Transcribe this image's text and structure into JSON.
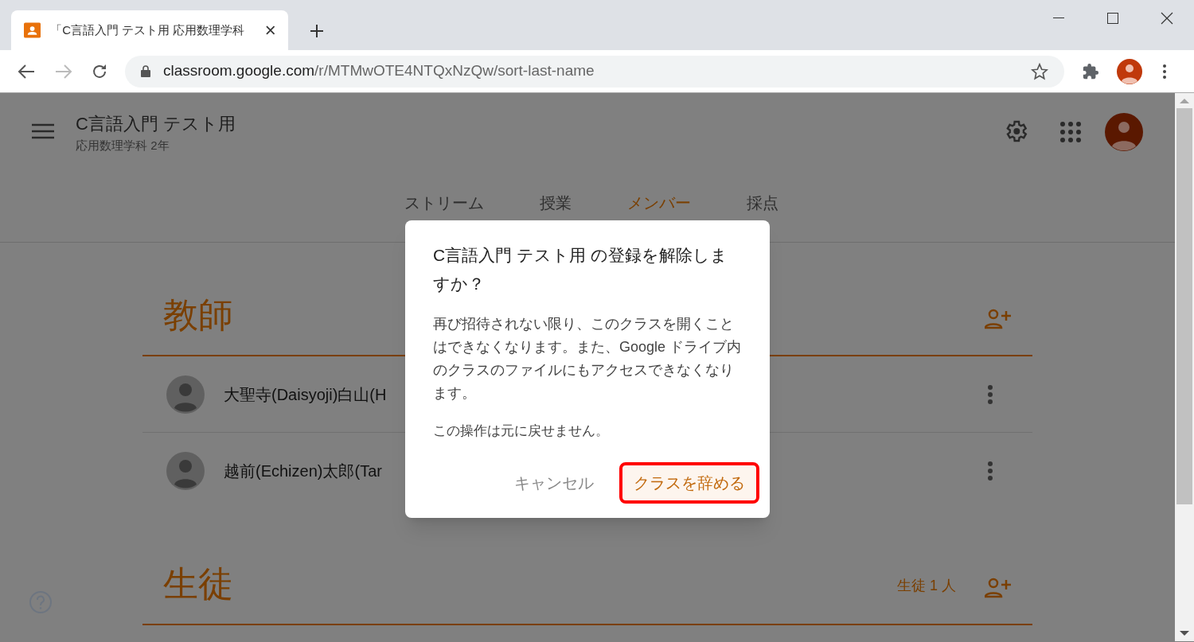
{
  "browser": {
    "tab_title": "「C言語入門 テスト用 応用数理学科",
    "url_host": "classroom.google.com",
    "url_path": "/r/MTMwOTE4NTQxNzQw/sort-last-name"
  },
  "header": {
    "class_name": "C言語入門 テスト用",
    "section": "応用数理学科 2年"
  },
  "tabs": [
    {
      "label": "ストリーム",
      "selected": false
    },
    {
      "label": "授業",
      "selected": false
    },
    {
      "label": "メンバー",
      "selected": true
    },
    {
      "label": "採点",
      "selected": false
    }
  ],
  "teachers": {
    "heading": "教師",
    "members": [
      {
        "name": "大聖寺(Daisyoji)白山(H"
      },
      {
        "name": "越前(Echizen)太郎(Tar"
      }
    ]
  },
  "students": {
    "heading": "生徒",
    "count": "生徒 1 人"
  },
  "dialog": {
    "title": "C言語入門 テスト用 の登録を解除しますか？",
    "body": "再び招待されない限り、このクラスを開くことはできなくなります。また、Google ドライブ内のクラスのファイルにもアクセスできなくなります。",
    "note": "この操作は元に戻せません。",
    "buttons": [
      {
        "label": "キャンセル",
        "kind": "cancel",
        "highlighted": false
      },
      {
        "label": "クラスを辞める",
        "kind": "confirm",
        "highlighted": true
      }
    ]
  }
}
